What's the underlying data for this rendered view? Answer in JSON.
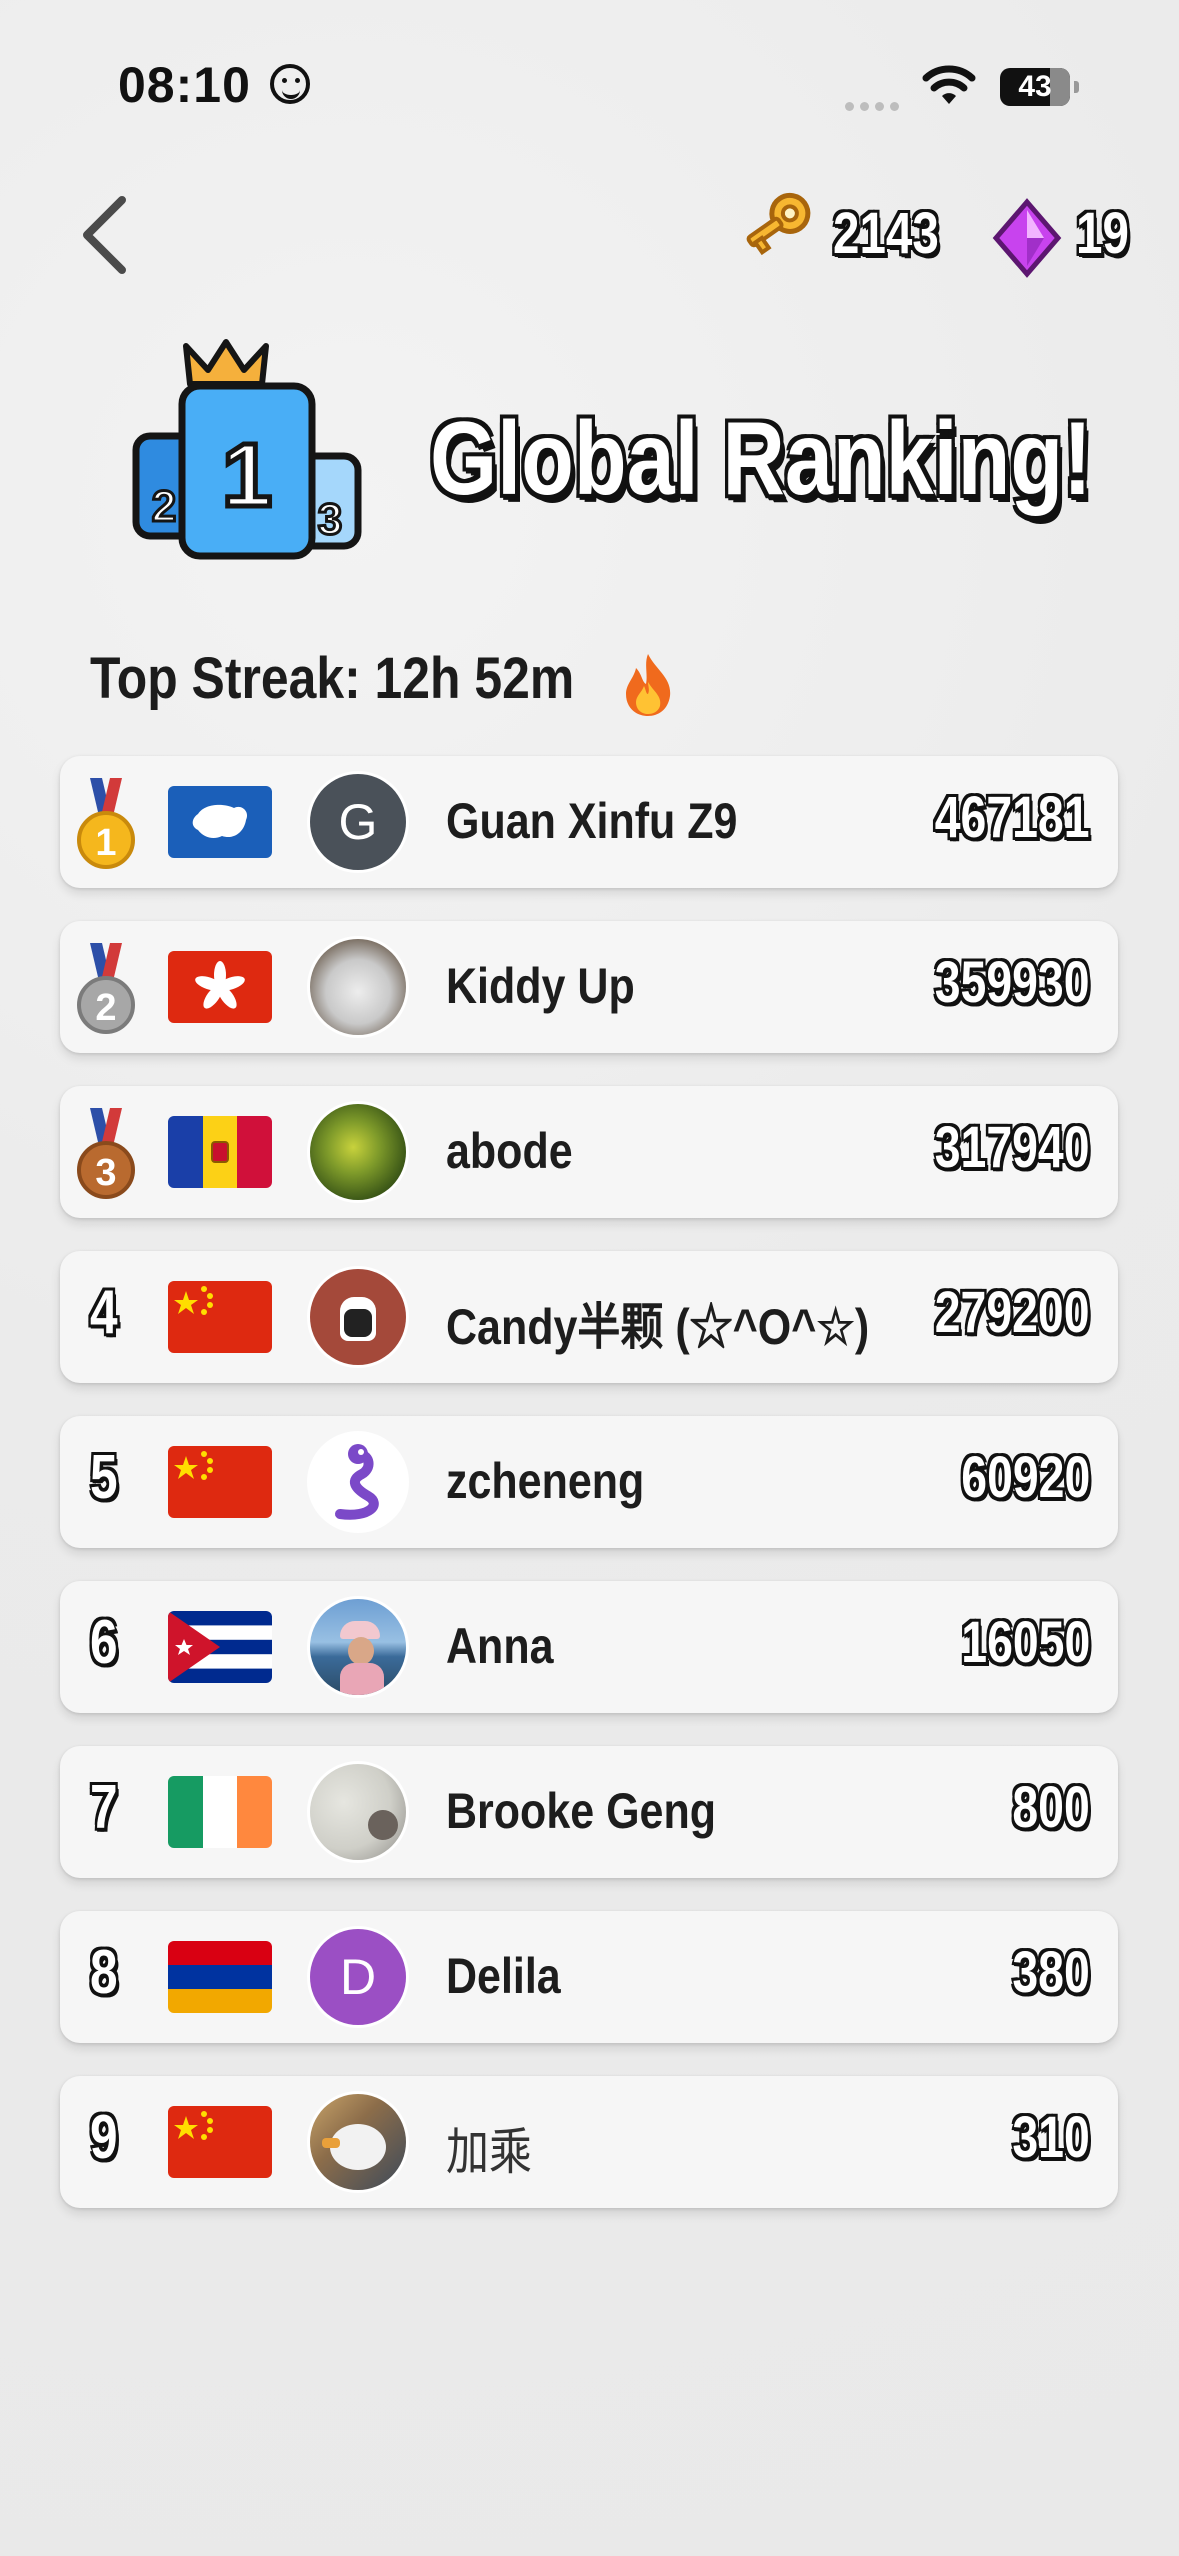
{
  "status": {
    "time": "08:10",
    "battery": "43"
  },
  "header": {
    "keys": "2143",
    "gems": "19"
  },
  "title": "Global Ranking!",
  "streak": "Top Streak: 12h 52m",
  "leaderboard": [
    {
      "rank": "1",
      "flag": "antarctica",
      "avatar": "G",
      "avatar_color": "#4a5159",
      "name": "Guan Xinfu Z9",
      "score": "467181"
    },
    {
      "rank": "2",
      "flag": "hong-kong",
      "avatar": "cat-photo",
      "name": "Kiddy Up",
      "score": "359930"
    },
    {
      "rank": "3",
      "flag": "andorra",
      "avatar": "fruit-photo",
      "name": "abode",
      "score": "317940"
    },
    {
      "rank": "4",
      "flag": "china",
      "avatar": "cartoon-photo",
      "name": "Candy半颗 (☆^O^☆)",
      "score": "279200"
    },
    {
      "rank": "5",
      "flag": "china",
      "avatar": "dragon-photo",
      "name": "zcheneng",
      "score": "60920"
    },
    {
      "rank": "6",
      "flag": "cuba",
      "avatar": "person-photo",
      "name": "Anna",
      "score": "16050"
    },
    {
      "rank": "7",
      "flag": "ireland",
      "avatar": "grey-photo",
      "name": "Brooke Geng",
      "score": "800"
    },
    {
      "rank": "8",
      "flag": "armenia",
      "avatar": "D",
      "avatar_color": "#9b4fc4",
      "name": "Delila",
      "score": "380"
    },
    {
      "rank": "9",
      "flag": "china",
      "avatar": "bird-photo",
      "name": "加乘",
      "score": "310"
    }
  ]
}
